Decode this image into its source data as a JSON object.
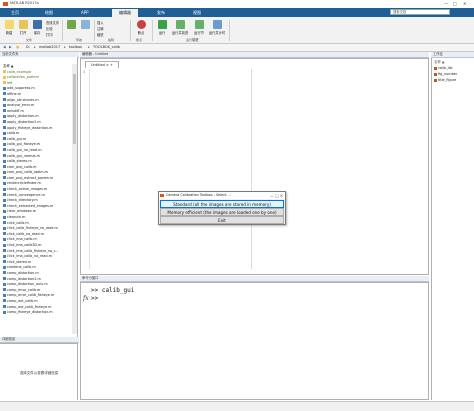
{
  "window": {
    "title": "MATLAB R2017a",
    "controls": [
      "—",
      "□",
      "✕"
    ]
  },
  "ribbon": {
    "tabs": [
      "主页",
      "绘图",
      "APP",
      "编辑器",
      "发布",
      "视图"
    ],
    "active_tab": "编辑器",
    "search_placeholder": "搜索文档",
    "buttons": {
      "new": "新建",
      "open": "打开",
      "save": "保存",
      "compare": "比较",
      "print": "打印",
      "find_files": "查找文件",
      "insert": "插入",
      "comment": "注释",
      "indent": "缩进",
      "breakpoints": "断点",
      "run": "运行",
      "run_advance": "运行并前进",
      "run_section": "运行节",
      "advance": "前进",
      "run_time": "运行并计时"
    },
    "sections": {
      "file": "文件",
      "navigate": "导航",
      "edit": "编辑",
      "breakpoints": "断点",
      "run": "运行"
    }
  },
  "pathbar": {
    "segments": [
      "D:",
      "matlab2017",
      "toolbox",
      "TOOLBOX_calib"
    ]
  },
  "current_folder": {
    "title": "当前文件夹",
    "files": [
      "名称 ▲",
      "calib_example",
      "calibration_pattern",
      "left",
      "add_suppress.m",
      "affine.m",
      "align_structures.m",
      "analyse_error.m",
      "anisdiff.m",
      "apply_distortion.m",
      "apply_distortion2.m",
      "apply_fisheye_distortion.m",
      "calib.m",
      "calib_gui.m",
      "calib_gui_fisheye.m",
      "calib_gui_no_read.m",
      "calib_gui_normal.m",
      "calib_stereo.m",
      "cam_proj_calib.m",
      "cam_proj_calib_optim.m",
      "cam_proj_extract_param.m",
      "centercirclefinder.m",
      "check_active_images.m",
      "check_convergence.m",
      "check_directory.m",
      "check_extracted_images.m",
      "clear_windows.m",
      "cleanzin.m",
      "click_calib.m",
      "click_calib_fisheye_no_read.m",
      "click_calib_no_read.m",
      "click_ima_calib.m",
      "click_ima_calib3D.m",
      "click_ima_calib_fisheye_no_r...",
      "click_ima_calib_no_read.m",
      "click_stereo.m",
      "combine_calib.m",
      "comp_distortion.m",
      "comp_distortion2.m",
      "comp_distortion_oulu.m",
      "comp_error_calib.m",
      "comp_error_calib_fisheye.m",
      "comp_ext_calib.m",
      "comp_ext_calib_fisheye.m",
      "comp_fisheye_distortion.m"
    ]
  },
  "details": {
    "title": "详细信息",
    "message": "选择文件以查看详细信息"
  },
  "editor": {
    "header": "编辑器 - Untitled",
    "tab": "Untitled",
    "line": "1"
  },
  "command_window": {
    "title": "命令行窗口",
    "lines": [
      ">> calib_gui",
      ">>"
    ],
    "fx": "fx"
  },
  "workspace": {
    "title": "工作区",
    "header": "名称 ▲",
    "items": [
      "calib_list",
      "fig_number",
      "title_figure"
    ]
  },
  "dialog": {
    "title": "Camera Calibration Toolbox - Select ...",
    "controls": [
      "—",
      "□",
      "✕"
    ],
    "options": [
      "Standard (all the images are stored in memory)",
      "Memory efficient (the images are loaded one by one)",
      "Exit"
    ]
  },
  "colors": {
    "accent": "#1f5f96",
    "matlab_logo": "#d9541e",
    "folder": "#e8c35a",
    "mfile": "#4a7fb5"
  }
}
